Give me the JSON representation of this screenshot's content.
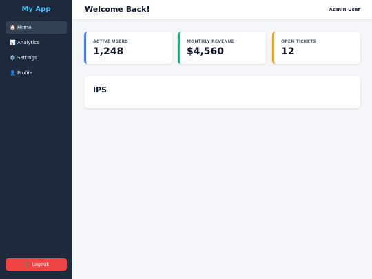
{
  "app": {
    "name": "My App"
  },
  "nav": {
    "items": [
      {
        "label": "Home",
        "icon": "🏠",
        "active": true
      },
      {
        "label": "Analytics",
        "icon": "📊",
        "active": false
      },
      {
        "label": "Settings",
        "icon": "⚙️",
        "active": false
      },
      {
        "label": "Profile",
        "icon": "👤",
        "active": false
      }
    ]
  },
  "logout": {
    "label": "Logout",
    "icon": "🚪"
  },
  "header": {
    "title": "Welcome Back!",
    "user": "Admin User"
  },
  "stats": [
    {
      "label": "ACTIVE USERS",
      "value": "1,248",
      "accent": "#3b82f6"
    },
    {
      "label": "MONTHLY REVENUE",
      "value": "$4,560",
      "accent": "#10b981"
    },
    {
      "label": "OPEN TICKETS",
      "value": "12",
      "accent": "#f59e0b"
    }
  ],
  "panel": {
    "title": "IPS"
  },
  "colors": {
    "sidebar": "#1e293b",
    "brand": "#38bdf8",
    "active_nav": "#334155",
    "logout": "#ef4444",
    "background": "#f4f6f9"
  }
}
